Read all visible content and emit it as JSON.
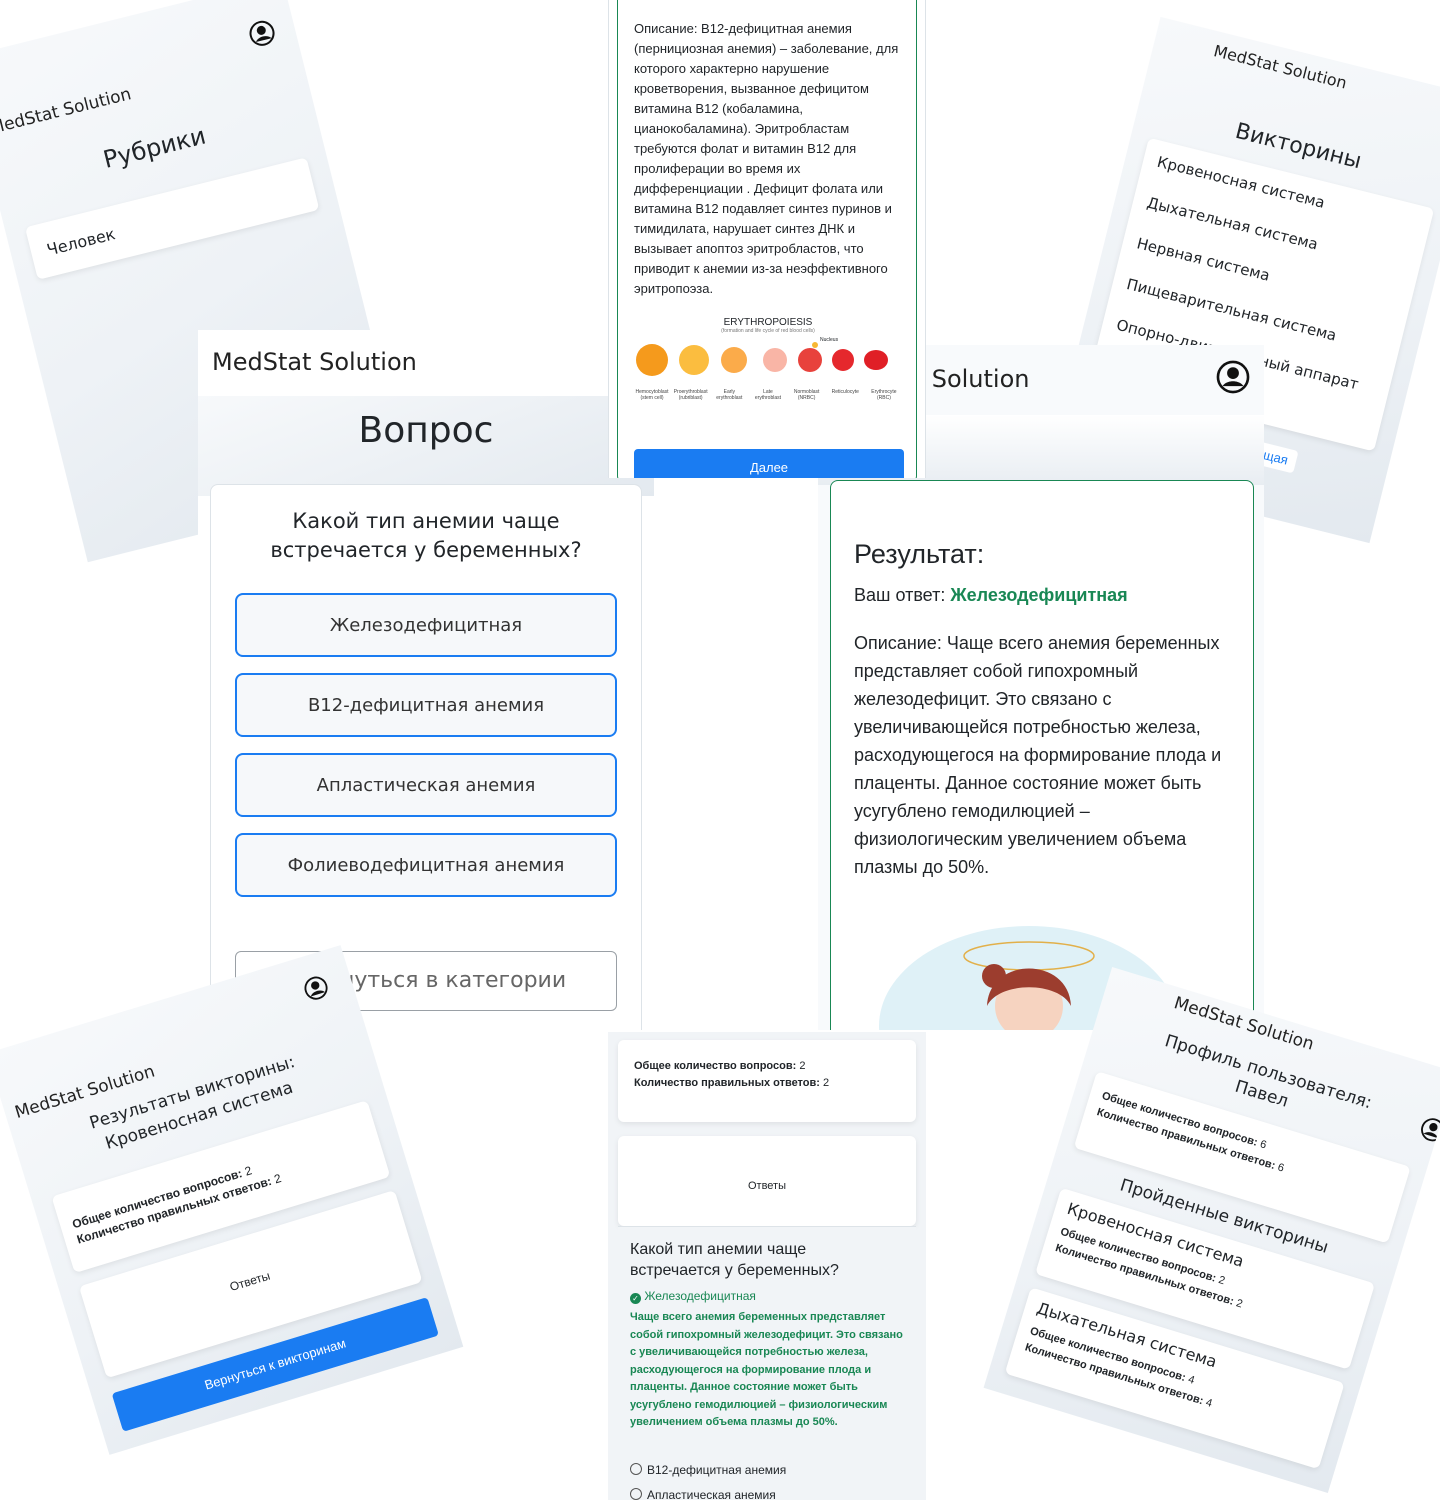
{
  "app": {
    "brand": "MedStat Solution",
    "brand_partial": ": Solution"
  },
  "categories": {
    "title": "Рубрики",
    "items": [
      "Человек"
    ]
  },
  "description_card": {
    "text": "Описание: B12-дефицитная анемия (пернициозная анемия) – заболевание, для которого характерно нарушение кроветворения, вызванное дефицитом витамина B12 (кобаламина, цианокобаламина). Эритробластам требуются фолат и витамин B12 для пролиферации во время их дифференциации . Дефицит фолата или витамина B12 подавляет синтез пуринов и тимидилата, нарушает синтез ДНК и вызывает апоптоз эритробластов, что приводит к анемии из-за неэффективного эритропоэза.",
    "diagram_title": "ERYTHROPOIESIS",
    "diagram_subtitle": "(formation and life cycle of red blood cells)",
    "nucleus_label": "Nucleus",
    "cells": [
      "Hemocytoblast (stem cell)",
      "Proerythroblast (rubriblast)",
      "Early erythroblast",
      "Late erythroblast",
      "Normoblast (NRBC)",
      "Reticulocyte",
      "Erythrocyte (RBC)"
    ],
    "next_button": "Далее"
  },
  "quizzes": {
    "title": "Викторины",
    "items": [
      "Кровеносная система",
      "Дыхательная система",
      "Нервная система",
      "Пищеварительная система",
      "Опорно-двигательный аппарат"
    ],
    "next_link": "Следующая"
  },
  "question": {
    "header": "Вопрос",
    "text": "Какой тип анемии чаще встречается у беременных?",
    "answers": [
      "Железодефицитная",
      "B12-дефицитная анемия",
      "Апластическая анемия",
      "Фолиеводефицитная анемия"
    ],
    "back_button": "рнуться в категории"
  },
  "result": {
    "title": "Результат:",
    "your_answer_label": "Ваш ответ:",
    "your_answer_value": "Железодефицитная",
    "description": "Описание: Чаще всего анемия беременных представляет собой гипохромный железодефицит. Это связано с увеличивающейся потребностью железа, расходующегося на формирование плода и плаценты. Данное состояние может быть усугублено гемодилюцией – физиологическим увеличением объема плазмы до 50%."
  },
  "quiz_results": {
    "title_line1": "Результаты викторины:",
    "title_line2": "Кровеносная система",
    "total_label": "Общее количество вопросов:",
    "total_value": "2",
    "correct_label": "Количество правильных ответов:",
    "correct_value": "2",
    "answers_tab": "Ответы",
    "back_button": "Вернуться к викторинам"
  },
  "answers_view": {
    "total_label": "Общее количество вопросов:",
    "total_value": "2",
    "correct_label": "Количество правильных ответов:",
    "correct_value": "2",
    "tab": "Ответы",
    "question": "Какой тип анемии чаще встречается у беременных?",
    "correct_option": "Железодефицитная",
    "explanation": "Чаще всего анемия беременных представляет собой гипохромный железодефицит. Это связано с увеличивающейся потребностью железа, расходующегося на формирование плода и плаценты. Данное состояние может быть усугублено гемодилюцией – физиологическим увеличением объема плазмы до 50%.",
    "other_options": [
      "B12-дефицитная анемия",
      "Апластическая анемия"
    ]
  },
  "profile": {
    "title_line1": "Профиль пользователя:",
    "title_line2": "Павел",
    "total_label": "Общее количество вопросов:",
    "total_value": "6",
    "correct_label": "Количество правильных ответов:",
    "correct_value": "6",
    "passed_title": "Пройденные викторины",
    "passed": [
      {
        "name": "Кровеносная система",
        "total_label": "Общее количество вопросов:",
        "total": "2",
        "correct_label": "Количество правильных ответов:",
        "correct": "2"
      },
      {
        "name": "Дыхательная система",
        "total_label": "Общее количество вопросов:",
        "total": "4",
        "correct_label": "Количество правильных ответов:",
        "correct": "4"
      }
    ]
  },
  "colors": {
    "accent": "#1a7cf2",
    "success": "#198754",
    "header_grad": "#e3e9ef"
  },
  "icons": [
    "user-circle-icon",
    "check-circle-icon",
    "radio-icon"
  ]
}
